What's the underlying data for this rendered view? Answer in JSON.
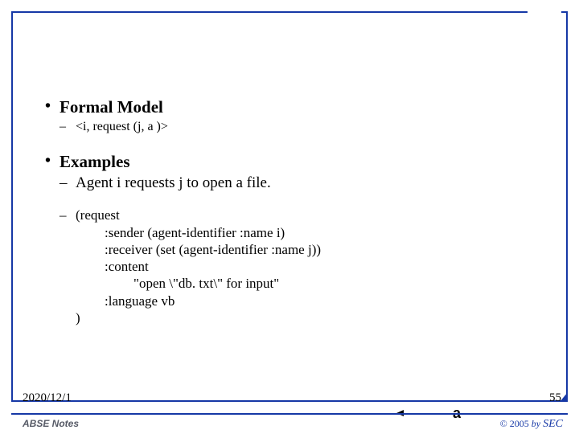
{
  "section1": {
    "title": "Formal Model",
    "item": "<i, request (j, a )>"
  },
  "section2": {
    "title": "Examples",
    "desc": "Agent i requests j to open a file.",
    "code": {
      "l0": "(request",
      "l1": ":sender (agent-identifier :name i)",
      "l2": ":receiver (set (agent-identifier :name j))",
      "l3": ":content",
      "l4": "\"open \\\"db. txt\\\" for input\"",
      "l5": ":language vb",
      "l6": ")"
    }
  },
  "annotation": "a",
  "date": "2020/12/1",
  "page": "55",
  "footer": {
    "notes": "ABSE Notes",
    "copyright": "© 2005",
    "by": "by",
    "org": "SEC"
  }
}
